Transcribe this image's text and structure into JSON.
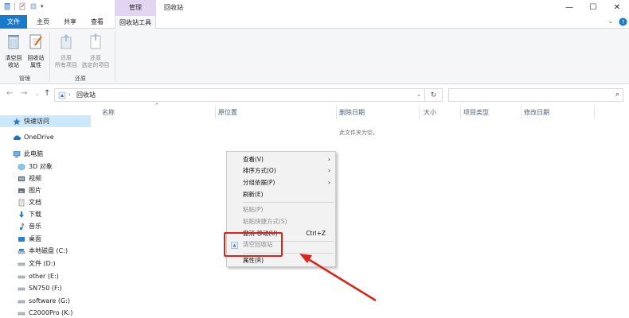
{
  "window": {
    "title": "回收站",
    "context_group_label": "管理",
    "tabs": [
      {
        "label": "文件"
      },
      {
        "label": "主页"
      },
      {
        "label": "共享"
      },
      {
        "label": "查看"
      },
      {
        "label": "回收站工具"
      }
    ],
    "accent_color": "#1979ca",
    "context_tab_color": "#e3d4f2"
  },
  "ribbon": {
    "groups": [
      {
        "label": "管理",
        "buttons": [
          {
            "line1": "清空回",
            "line2": "收站",
            "icon": "empty-bin-icon"
          },
          {
            "line1": "回收站",
            "line2": "属性",
            "icon": "bin-properties-icon"
          }
        ]
      },
      {
        "label": "还原",
        "buttons": [
          {
            "line1": "还原",
            "line2": "所有项目",
            "icon": "restore-all-icon"
          },
          {
            "line1": "还原",
            "line2": "选定的项目",
            "icon": "restore-selected-icon"
          }
        ]
      }
    ]
  },
  "address_bar": {
    "path": "回收站"
  },
  "sidebar": {
    "items": [
      {
        "label": "快速访问",
        "icon": "star-icon"
      },
      {
        "label": "OneDrive",
        "icon": "cloud-icon"
      },
      {
        "label": "此电脑",
        "icon": "computer-icon"
      },
      {
        "label": "3D 对象",
        "icon": "cube-icon"
      },
      {
        "label": "视频",
        "icon": "video-icon"
      },
      {
        "label": "图片",
        "icon": "picture-icon"
      },
      {
        "label": "文档",
        "icon": "document-icon"
      },
      {
        "label": "下载",
        "icon": "download-icon"
      },
      {
        "label": "音乐",
        "icon": "music-icon"
      },
      {
        "label": "桌面",
        "icon": "desktop-icon"
      },
      {
        "label": "本地磁盘 (C:)",
        "icon": "drive-icon"
      },
      {
        "label": "文件 (D:)",
        "icon": "drive-icon"
      },
      {
        "label": "other (E:)",
        "icon": "drive-icon"
      },
      {
        "label": "SN750 (F:)",
        "icon": "drive-icon"
      },
      {
        "label": "software (G:)",
        "icon": "drive-icon"
      },
      {
        "label": "C2000Pro (K:)",
        "icon": "drive-icon"
      }
    ]
  },
  "content": {
    "columns": [
      "名称",
      "原位置",
      "删除日期",
      "大小",
      "项目类型",
      "修改日期"
    ],
    "empty_message": "此文件夹为空。"
  },
  "context_menu": {
    "items": [
      {
        "label": "查看(V)",
        "submenu": true,
        "disabled": false
      },
      {
        "label": "排序方式(O)",
        "submenu": true,
        "disabled": false
      },
      {
        "label": "分组依据(P)",
        "submenu": true,
        "disabled": false
      },
      {
        "label": "刷新(E)",
        "submenu": false,
        "disabled": false
      },
      {
        "label": "粘贴(P)",
        "submenu": false,
        "disabled": true
      },
      {
        "label": "粘贴快捷方式(S)",
        "submenu": false,
        "disabled": true
      },
      {
        "label": "撤消 移动(U)",
        "shortcut": "Ctrl+Z",
        "disabled": false
      },
      {
        "label": "清空回收站",
        "submenu": false,
        "disabled": true,
        "icon": "recycle-bin-icon"
      },
      {
        "label": "属性(R)",
        "submenu": false,
        "disabled": false
      }
    ]
  },
  "annotation": {
    "color": "#d9261c"
  }
}
